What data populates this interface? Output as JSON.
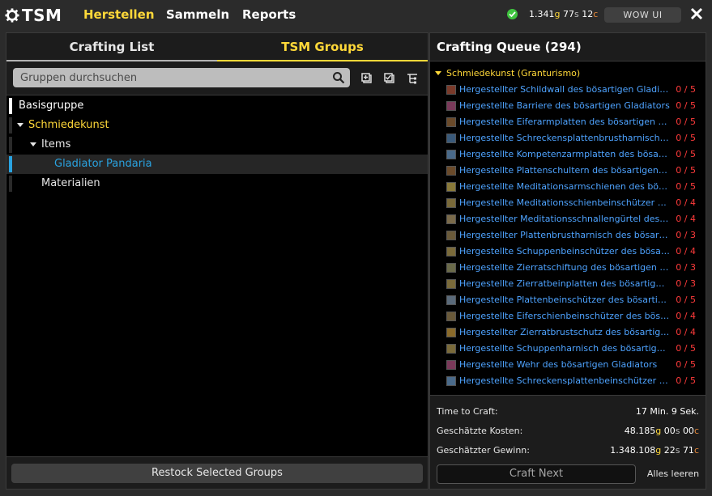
{
  "app": {
    "logo_text": "TSM",
    "nav": [
      "Herstellen",
      "Sammeln",
      "Reports"
    ],
    "gold_g": "1.341",
    "gold_s": "77",
    "gold_c": "12",
    "wow_ui_label": "WOW UI"
  },
  "left": {
    "tab_crafting": "Crafting List",
    "tab_groups": "TSM Groups",
    "search_placeholder": "Gruppen durchsuchen",
    "tree": [
      {
        "label": "Basisgruppe"
      },
      {
        "label": "Schmiedekunst"
      },
      {
        "label": "Items"
      },
      {
        "label": "Gladiator Pandaria"
      },
      {
        "label": "Materialien"
      }
    ],
    "restock_label": "Restock Selected Groups"
  },
  "right": {
    "title": "Crafting Queue (294)",
    "category": "Schmiedekunst (Granturismo)",
    "items": [
      {
        "name": "Hergestellter Schildwall des bösartigen Gladiators",
        "count": "0 / 5",
        "icon": "shield-icon",
        "color": "#7a3a2a"
      },
      {
        "name": "Hergestellte Barriere des bösartigen Gladiators",
        "count": "0 / 5",
        "icon": "barrier-icon",
        "color": "#7a3a5a"
      },
      {
        "name": "Hergestellte Eiferarmplatten des bösartigen Gladiators",
        "count": "0 / 5",
        "icon": "bracer-icon",
        "color": "#6a4a2a"
      },
      {
        "name": "Hergestellte Schreckensplattenbrustharnisch des bösartigen Gladiators",
        "count": "0 / 5",
        "icon": "chest-icon",
        "color": "#3a5a7a"
      },
      {
        "name": "Hergestellte Kompetenzarmplatten des bösartigen Gladiators",
        "count": "0 / 5",
        "icon": "bracer-icon",
        "color": "#4a6a8a"
      },
      {
        "name": "Hergestellte Plattenschultern des bösartigen Gladiators",
        "count": "0 / 5",
        "icon": "shoulder-icon",
        "color": "#6a4a2a"
      },
      {
        "name": "Hergestellte Meditationsarmschienen des bösartigen Gladiators",
        "count": "0 / 5",
        "icon": "bracer-icon",
        "color": "#8a7a3a"
      },
      {
        "name": "Hergestellte Meditationsschienbeinschützer des bösartigen Gladiators",
        "count": "0 / 4",
        "icon": "legs-icon",
        "color": "#7a6a3a"
      },
      {
        "name": "Hergestellter Meditationsschnallengürtel des bösartigen Gladiators",
        "count": "0 / 4",
        "icon": "belt-icon",
        "color": "#7a6a4a"
      },
      {
        "name": "Hergestellter Plattenbrustharnisch des bösartigen Gladiators",
        "count": "0 / 3",
        "icon": "chest-icon",
        "color": "#6a5a3a"
      },
      {
        "name": "Hergestellte Schuppenbeinschützer des bösartigen Gladiators",
        "count": "0 / 4",
        "icon": "legs-icon",
        "color": "#7a6a3a"
      },
      {
        "name": "Hergestellte Zierratschiftung des bösartigen Gladiators",
        "count": "0 / 3",
        "icon": "chest-icon",
        "color": "#6a6a4a"
      },
      {
        "name": "Hergestellte Zierratbeinplatten des bösartigen Gladiators",
        "count": "0 / 3",
        "icon": "legs-icon",
        "color": "#7a6a3a"
      },
      {
        "name": "Hergestellte Plattenbeinschützer des bösartigen Gladiators",
        "count": "0 / 5",
        "icon": "legs-icon",
        "color": "#5a6a7a"
      },
      {
        "name": "Hergestellte Eiferschienbeinschützer des bösartigen Gladiators",
        "count": "0 / 4",
        "icon": "legs-icon",
        "color": "#6a5a3a"
      },
      {
        "name": "Hergestellter Zierratbrustschutz des bösartigen Gladiators",
        "count": "0 / 4",
        "icon": "chest-icon",
        "color": "#8a6a2a"
      },
      {
        "name": "Hergestellte Schuppenharnisch des bösartigen Gladiators",
        "count": "0 / 5",
        "icon": "chest-icon",
        "color": "#7a6a3a"
      },
      {
        "name": "Hergestellte Wehr des bösartigen Gladiators",
        "count": "0 / 5",
        "icon": "shield-icon",
        "color": "#7a3a5a"
      },
      {
        "name": "Hergestellte Schreckensplattenbeinschützer des bösartigen Gladiators",
        "count": "0 / 5",
        "icon": "legs-icon",
        "color": "#4a6a8a"
      }
    ],
    "time_label": "Time to Craft:",
    "time_value": "17 Min. 9 Sek.",
    "cost_label": "Geschätzte Kosten:",
    "cost_g": "48.185",
    "cost_s": "00",
    "cost_c": "00",
    "profit_label": "Geschätzter Gewinn:",
    "profit_g": "1.348.108",
    "profit_s": "22",
    "profit_c": "71",
    "craft_next_label": "Craft Next",
    "clear_all_label": "Alles leeren"
  }
}
